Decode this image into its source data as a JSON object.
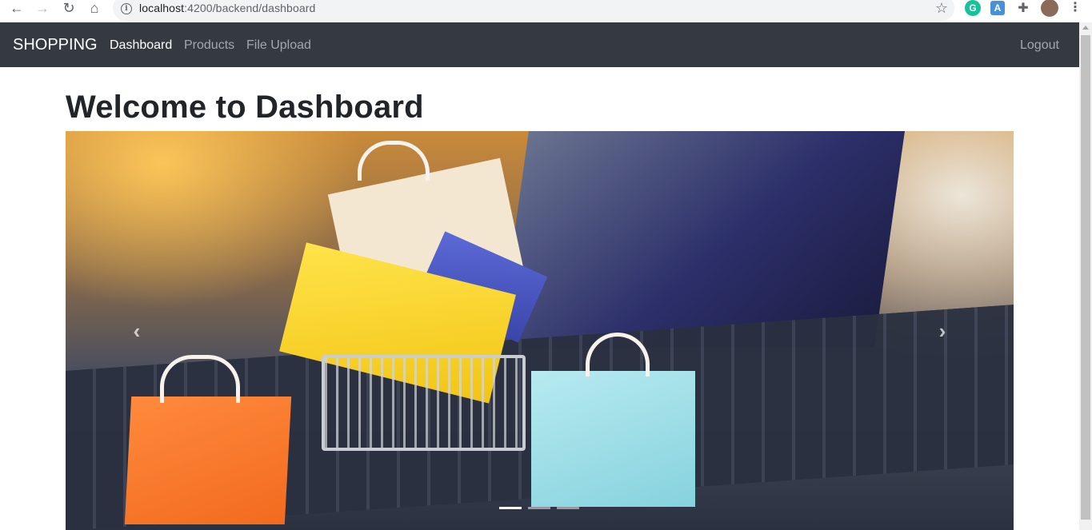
{
  "browser": {
    "url_host": "localhost",
    "url_path": ":4200/backend/dashboard",
    "back_icon": "←",
    "forward_icon": "→",
    "reload_icon": "↻",
    "home_icon": "⌂",
    "star_icon": "☆",
    "ext_grammarly": "G",
    "ext_translate": "A",
    "ext_puzzle": "✚",
    "menu_icon": "⋮"
  },
  "navbar": {
    "brand": "SHOPPING",
    "links": [
      {
        "label": "Dashboard",
        "active": true
      },
      {
        "label": "Products",
        "active": false
      },
      {
        "label": "File Upload",
        "active": false
      }
    ],
    "logout": "Logout"
  },
  "main": {
    "title": "Welcome to Dashboard"
  },
  "carousel": {
    "prev_icon": "‹",
    "next_icon": "›",
    "indicators_count": 3,
    "active_index": 0
  },
  "colors": {
    "navbar_bg": "#343a40",
    "brand": "#ffffff",
    "link_muted": "rgba(255,255,255,0.55)",
    "title": "#212529"
  }
}
